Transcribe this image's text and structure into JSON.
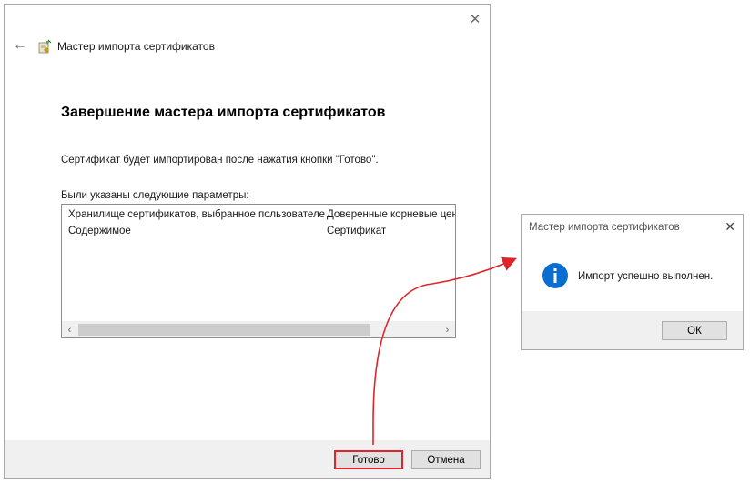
{
  "wizard": {
    "title": "Мастер импорта сертификатов",
    "close_glyph": "✕",
    "back_glyph": "←",
    "heading": "Завершение мастера импорта сертификатов",
    "info_text": "Сертификат будет импортирован после нажатия кнопки \"Готово\".",
    "params_label": "Были указаны следующие параметры:",
    "params_rows": [
      {
        "name": "Хранилище сертификатов, выбранное пользователем",
        "value": "Доверенные корневые центры сертификации"
      },
      {
        "name": "Содержимое",
        "value": "Сертификат"
      }
    ],
    "scroll_left_glyph": "‹",
    "scroll_right_glyph": "›",
    "finish_label": "Готово",
    "cancel_label": "Отмена"
  },
  "message_box": {
    "title": "Мастер импорта сертификатов",
    "close_glyph": "✕",
    "text": "Импорт успешно выполнен.",
    "ok_label": "ОК",
    "icon": "info-icon"
  },
  "colors": {
    "highlight": "#e0242b",
    "info_blue": "#0a6ed1"
  }
}
